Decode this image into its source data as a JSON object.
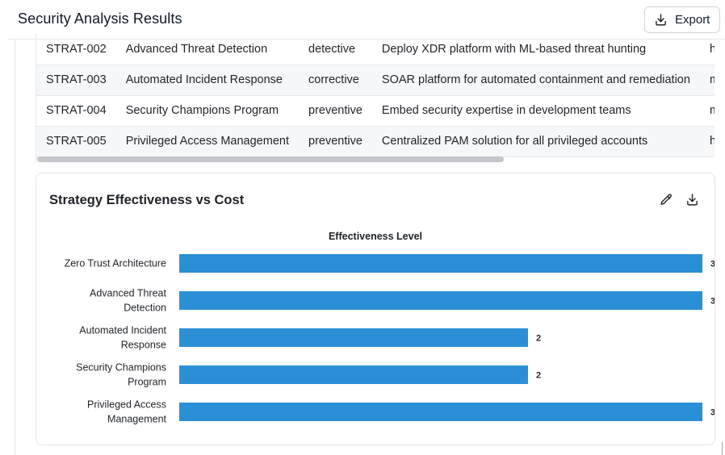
{
  "header": {
    "title": "Security Analysis Results",
    "export_label": "Export"
  },
  "table": {
    "rows": [
      {
        "id": "STRAT-002",
        "name": "Advanced Threat Detection",
        "type": "detective",
        "description": "Deploy XDR platform with ML-based threat hunting",
        "extra": "h"
      },
      {
        "id": "STRAT-003",
        "name": "Automated Incident Response",
        "type": "corrective",
        "description": "SOAR platform for automated containment and remediation",
        "extra": "m"
      },
      {
        "id": "STRAT-004",
        "name": "Security Champions Program",
        "type": "preventive",
        "description": "Embed security expertise in development teams",
        "extra": "m"
      },
      {
        "id": "STRAT-005",
        "name": "Privileged Access Management",
        "type": "preventive",
        "description": "Centralized PAM solution for all privileged accounts",
        "extra": "h"
      }
    ],
    "horizontal_scroll_fraction": 0.69
  },
  "chart_card": {
    "title": "Strategy Effectiveness vs Cost",
    "edit_icon": "pencil-icon",
    "download_icon": "download-icon"
  },
  "chart_data": {
    "type": "bar",
    "orientation": "horizontal",
    "title": "Effectiveness Level",
    "categories": [
      [
        "Zero Trust Architecture"
      ],
      [
        "Advanced Threat",
        "Detection"
      ],
      [
        "Automated Incident",
        "Response"
      ],
      [
        "Security Champions",
        "Program"
      ],
      [
        "Privileged Access",
        "Management"
      ]
    ],
    "values": [
      3,
      3,
      2,
      2,
      3
    ],
    "xlim": [
      0,
      3
    ],
    "bar_color": "#2b8fd6",
    "grid": false,
    "legend": "none"
  }
}
